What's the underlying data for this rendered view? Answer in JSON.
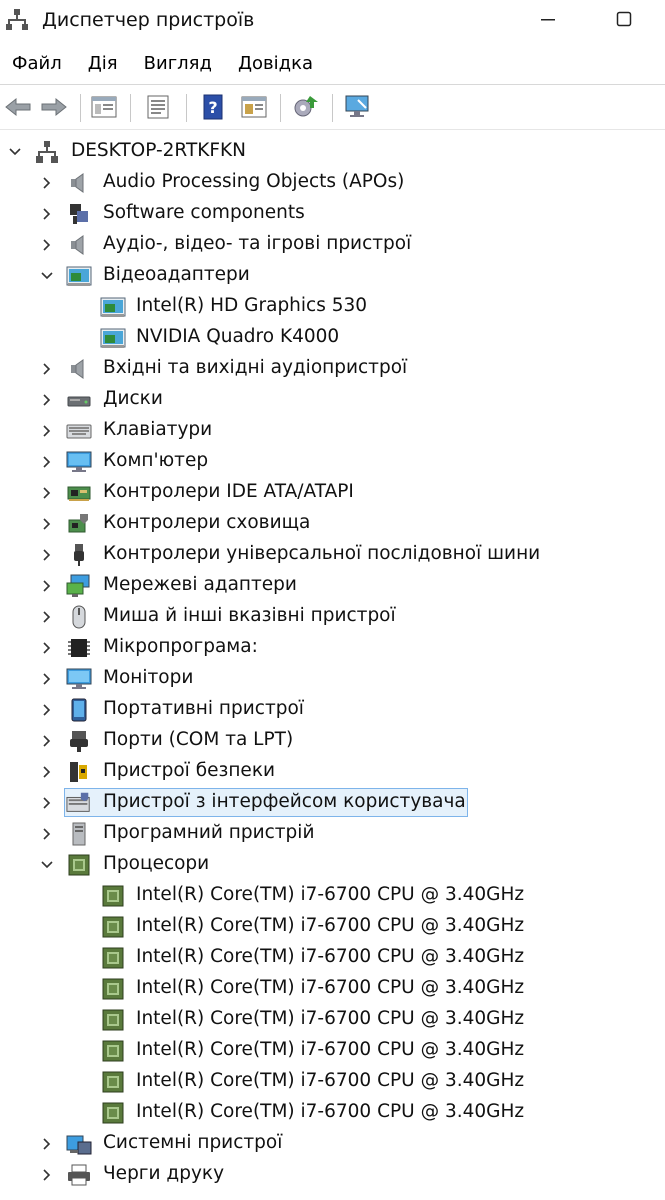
{
  "window": {
    "title": "Диспетчер пристроїв",
    "icon": "device-manager-icon",
    "buttons": [
      "minimize-icon",
      "maximize-icon"
    ]
  },
  "menu": [
    "Файл",
    "Дія",
    "Вигляд",
    "Довідка"
  ],
  "toolbar": [
    "back-arrow-icon",
    "forward-arrow-icon",
    "show-hide-tree-icon",
    "properties-icon",
    "help-icon",
    "view-icon",
    "update-driver-icon",
    "scan-hardware-icon"
  ],
  "tree": {
    "root": "DESKTOP-2RTKFKN",
    "nodes": [
      {
        "label": "Audio Processing Objects (APOs)",
        "icon": "speaker-icon",
        "expanded": false
      },
      {
        "label": "Software components",
        "icon": "software-component-icon",
        "expanded": false
      },
      {
        "label": "Аудіо-, відео- та ігрові пристрої",
        "icon": "speaker-icon",
        "expanded": false
      },
      {
        "label": "Відеоадаптери",
        "icon": "display-adapter-icon",
        "expanded": true,
        "children": [
          "Intel(R) HD Graphics 530",
          "NVIDIA Quadro K4000"
        ]
      },
      {
        "label": "Вхідні та вихідні аудіопристрої",
        "icon": "speaker-icon",
        "expanded": false
      },
      {
        "label": "Диски",
        "icon": "disk-drive-icon",
        "expanded": false
      },
      {
        "label": "Клавіатури",
        "icon": "keyboard-icon",
        "expanded": false
      },
      {
        "label": "Комп'ютер",
        "icon": "computer-icon",
        "expanded": false
      },
      {
        "label": "Контролери IDE ATA/ATAPI",
        "icon": "ide-controller-icon",
        "expanded": false
      },
      {
        "label": "Контролери сховища",
        "icon": "storage-controller-icon",
        "expanded": false
      },
      {
        "label": "Контролери універсальної послідовної шини",
        "icon": "usb-icon",
        "expanded": false
      },
      {
        "label": "Мережеві адаптери",
        "icon": "network-adapter-icon",
        "expanded": false
      },
      {
        "label": "Миша й інші вказівні пристрої",
        "icon": "mouse-icon",
        "expanded": false
      },
      {
        "label": "Мікропрограма:",
        "icon": "firmware-chip-icon",
        "expanded": false
      },
      {
        "label": "Монітори",
        "icon": "monitor-icon",
        "expanded": false
      },
      {
        "label": "Портативні пристрої",
        "icon": "portable-device-icon",
        "expanded": false
      },
      {
        "label": "Порти (COM та LPT)",
        "icon": "port-icon",
        "expanded": false
      },
      {
        "label": "Пристрої безпеки",
        "icon": "security-device-icon",
        "expanded": false
      },
      {
        "label": "Пристрої з інтерфейсом користувача",
        "icon": "hid-icon",
        "expanded": false,
        "selected": true
      },
      {
        "label": "Програмний пристрій",
        "icon": "software-device-icon",
        "expanded": false
      },
      {
        "label": "Процесори",
        "icon": "processor-icon",
        "expanded": true,
        "children": [
          "Intel(R) Core(TM) i7-6700 CPU @ 3.40GHz",
          "Intel(R) Core(TM) i7-6700 CPU @ 3.40GHz",
          "Intel(R) Core(TM) i7-6700 CPU @ 3.40GHz",
          "Intel(R) Core(TM) i7-6700 CPU @ 3.40GHz",
          "Intel(R) Core(TM) i7-6700 CPU @ 3.40GHz",
          "Intel(R) Core(TM) i7-6700 CPU @ 3.40GHz",
          "Intel(R) Core(TM) i7-6700 CPU @ 3.40GHz",
          "Intel(R) Core(TM) i7-6700 CPU @ 3.40GHz"
        ]
      },
      {
        "label": "Системні пристрої",
        "icon": "system-device-icon",
        "expanded": false
      },
      {
        "label": "Черги друку",
        "icon": "printer-icon",
        "expanded": false
      }
    ]
  }
}
